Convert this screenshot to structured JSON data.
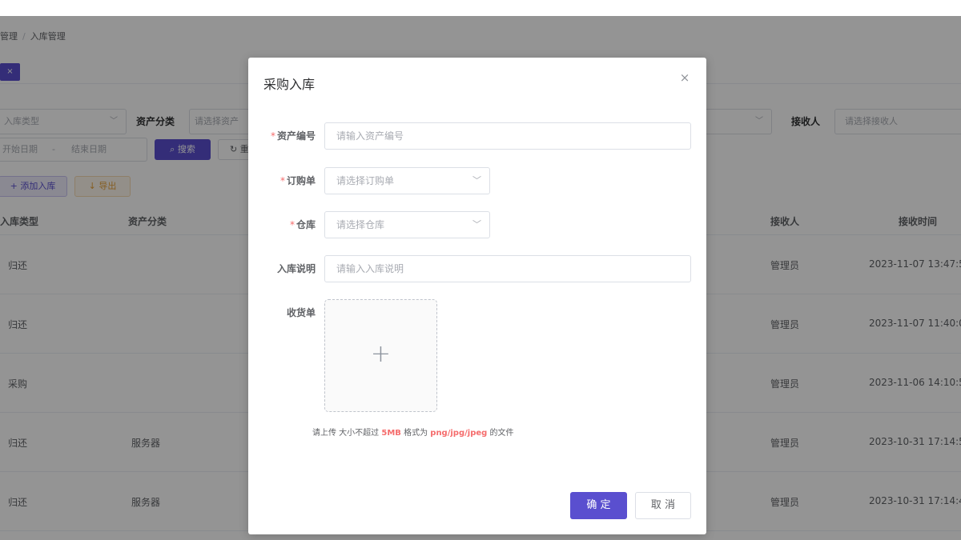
{
  "background": {
    "breadcrumb": [
      "管理",
      "入库管理"
    ],
    "breadcrumb_sep": "/",
    "active_tag_icon": "×",
    "filters": {
      "type_placeholder": "入库类型",
      "category_label": "资产分类",
      "category_placeholder": "请选择资产",
      "receiver_label": "接收人",
      "receiver_placeholder": "请选择接收人",
      "start_date": "开始日期",
      "date_sep": "-",
      "end_date": "结束日期",
      "search_button": "搜索",
      "reset_button": "重"
    },
    "add_button": "添加入库",
    "export_button": "导出",
    "table": {
      "columns": [
        "入库类型",
        "资产分类",
        "接收人",
        "接收时间"
      ],
      "rows": [
        {
          "type": "归还",
          "category": "",
          "receiver": "管理员",
          "time": "2023-11-07 13:47:5"
        },
        {
          "type": "归还",
          "category": "",
          "receiver": "管理员",
          "time": "2023-11-07 11:40:0"
        },
        {
          "type": "采购",
          "category": "",
          "receiver": "管理员",
          "time": "2023-11-06 14:10:5"
        },
        {
          "type": "归还",
          "category": "服务器",
          "receiver": "管理员",
          "time": "2023-10-31 17:14:5"
        },
        {
          "type": "归还",
          "category": "服务器",
          "receiver": "管理员",
          "time": "2023-10-31 17:14:4"
        }
      ]
    }
  },
  "dialog": {
    "title": "采购入库",
    "close_icon": "×",
    "fields": {
      "asset_no": {
        "label": "资产编号",
        "placeholder": "请输入资产编号",
        "required": "*"
      },
      "order": {
        "label": "订购单",
        "placeholder": "请选择订购单",
        "required": "*"
      },
      "warehouse": {
        "label": "仓库",
        "placeholder": "请选择仓库",
        "required": "*"
      },
      "note": {
        "label": "入库说明",
        "placeholder": "请输入入库说明"
      },
      "receipt": {
        "label": "收货单"
      }
    },
    "upload_tip": {
      "part1": "请上传 大小不超过",
      "size": "5MB",
      "part2": "格式为",
      "formats": "png/jpg/jpeg",
      "part3": "的文件"
    },
    "confirm_button": "确 定",
    "cancel_button": "取 消"
  },
  "colors": {
    "primary": "#5a4fcf",
    "required": "#f56c6c",
    "warning": "#e6a23c"
  }
}
